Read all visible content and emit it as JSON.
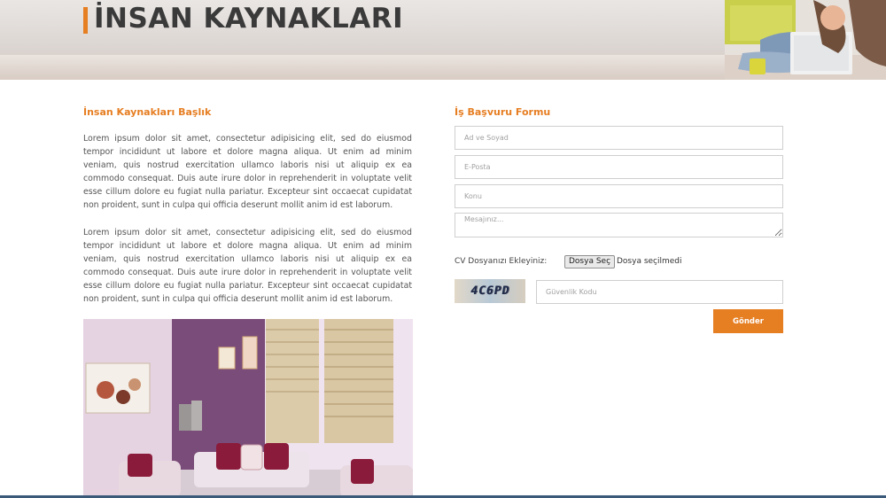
{
  "header": {
    "title": "İNSAN KAYNAKLARI"
  },
  "left": {
    "heading": "İnsan Kaynakları Başlık",
    "paragraphs": [
      "Lorem ipsum dolor sit amet, consectetur adipisicing elit, sed do eiusmod tempor incididunt ut labore et dolore magna aliqua. Ut enim ad minim veniam, quis nostrud exercitation ullamco laboris nisi ut aliquip ex ea commodo consequat. Duis aute irure dolor in reprehenderit in voluptate velit esse cillum dolore eu fugiat nulla pariatur. Excepteur sint occaecat cupidatat non proident, sunt in culpa qui officia deserunt mollit anim id est laborum.",
      "Lorem ipsum dolor sit amet, consectetur adipisicing elit, sed do eiusmod tempor incididunt ut labore et dolore magna aliqua. Ut enim ad minim veniam, quis nostrud exercitation ullamco laboris nisi ut aliquip ex ea commodo consequat. Duis aute irure dolor in reprehenderit in voluptate velit esse cillum dolore eu fugiat nulla pariatur. Excepteur sint occaecat cupidatat non proident, sunt in culpa qui officia deserunt mollit anim id est laborum."
    ]
  },
  "form": {
    "heading": "İş Başvuru Formu",
    "name_placeholder": "Ad ve Soyad",
    "email_placeholder": "E-Posta",
    "subject_placeholder": "Konu",
    "message_placeholder": "Mesajınız...",
    "cv_label": "CV Dosyanızı Ekleyiniz:",
    "file_button": "Dosya Seç",
    "file_status": "Dosya seçilmedi",
    "captcha_text": "4C6PD",
    "security_placeholder": "Güvenlik Kodu",
    "submit_label": "Gönder"
  },
  "colors": {
    "accent": "#e67e22",
    "title": "#3a3a3a"
  }
}
